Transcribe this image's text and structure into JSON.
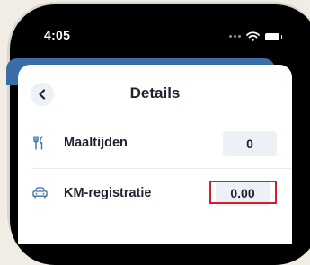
{
  "status_bar": {
    "time": "4:05"
  },
  "header": {
    "title": "Details"
  },
  "rows": [
    {
      "label": "Maaltijden",
      "value": "0",
      "icon": "cutlery-icon"
    },
    {
      "label": "KM-registratie",
      "value": "0.00",
      "icon": "car-icon"
    }
  ],
  "colors": {
    "header_strip": "#3b6ea8",
    "highlight": "#d0202a",
    "value_box": "#edf0f4"
  }
}
